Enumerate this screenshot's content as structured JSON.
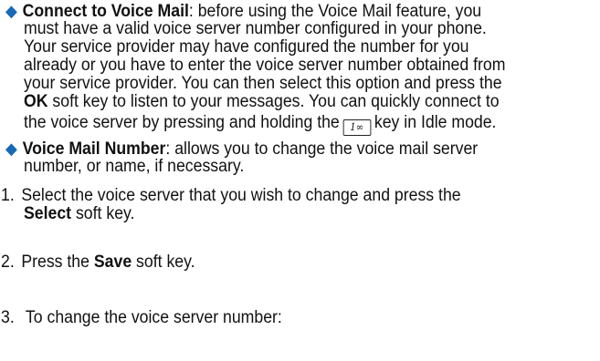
{
  "bullets": [
    {
      "icon": "diamond-bullet-icon",
      "term": "Connect to Voice Mail",
      "lines": [
        ": before using the Voice Mail feature, you",
        "must have a valid voice server number configured in your phone.",
        "Your service provider may have configured the number for you",
        "already or you have to enter the voice server number obtained from",
        "your service provider. You can then select this option and press the"
      ],
      "ok_key": "OK",
      "ok_line_rest": " soft key to listen to your messages. You can quickly connect to",
      "last_line_before_key": "the voice server by pressing and holding the",
      "key_label": "1∞",
      "last_line_after_key": "key in Idle mode."
    },
    {
      "icon": "diamond-bullet-icon",
      "term": "Voice Mail Number",
      "lines": [
        ": allows you to change the voice mail server",
        "number, or name, if necessary."
      ]
    }
  ],
  "steps": [
    {
      "number": "1.",
      "line1": "Select the voice server that you wish to change and press the",
      "bold": "Select",
      "line2_rest": " soft key."
    },
    {
      "number": "2.",
      "before": "Press the ",
      "bold": "Save",
      "after": " soft key."
    },
    {
      "number": "3.",
      "text": " To change the voice server number:"
    }
  ]
}
